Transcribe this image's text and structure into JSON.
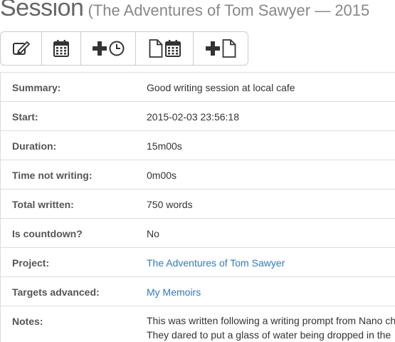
{
  "header": {
    "title": "Session",
    "subtitle": "(The Adventures of Tom Sawyer — 2015"
  },
  "toolbar": {
    "buttons": [
      {
        "name": "edit-button",
        "icon": "edit-icon"
      },
      {
        "name": "calendar-button",
        "icon": "calendar-icon"
      },
      {
        "name": "add-timer-button",
        "icon": "plus-clock-icon"
      },
      {
        "name": "document-calendar-button",
        "icon": "document-calendar-icon"
      },
      {
        "name": "add-document-button",
        "icon": "plus-document-icon"
      }
    ]
  },
  "details": {
    "summary_label": "Summary:",
    "summary_value": "Good writing session at local cafe",
    "start_label": "Start:",
    "start_value": "2015-02-03 23:56:18",
    "duration_label": "Duration:",
    "duration_value": "15m00s",
    "not_writing_label": "Time not writing:",
    "not_writing_value": "0m00s",
    "total_label": "Total written:",
    "total_value": "750 words",
    "countdown_label": "Is countdown?",
    "countdown_value": "No",
    "project_label": "Project:",
    "project_value": "The Adventures of Tom Sawyer",
    "targets_label": "Targets advanced:",
    "targets_value": "My Memoirs",
    "notes_label": "Notes:",
    "notes_line1": "This was written following a writing prompt from Nano ch",
    "notes_line2": "They dared to put a glass of water being dropped in the"
  },
  "colors": {
    "link": "#337ab7",
    "border": "#dddddd",
    "title": "#666666"
  }
}
